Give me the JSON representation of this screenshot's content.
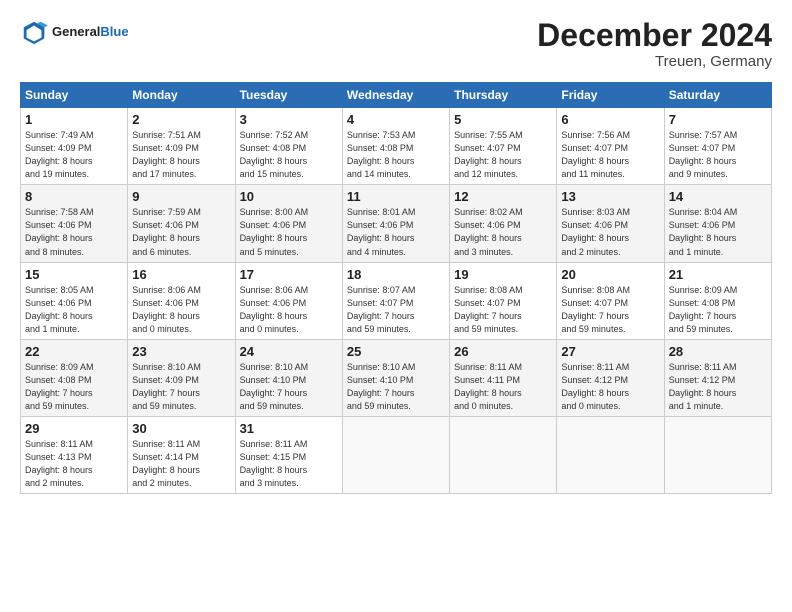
{
  "header": {
    "logo_line1": "General",
    "logo_line2": "Blue",
    "title": "December 2024",
    "subtitle": "Treuen, Germany"
  },
  "days_of_week": [
    "Sunday",
    "Monday",
    "Tuesday",
    "Wednesday",
    "Thursday",
    "Friday",
    "Saturday"
  ],
  "weeks": [
    [
      {
        "day": "1",
        "info": "Sunrise: 7:49 AM\nSunset: 4:09 PM\nDaylight: 8 hours\nand 19 minutes."
      },
      {
        "day": "2",
        "info": "Sunrise: 7:51 AM\nSunset: 4:09 PM\nDaylight: 8 hours\nand 17 minutes."
      },
      {
        "day": "3",
        "info": "Sunrise: 7:52 AM\nSunset: 4:08 PM\nDaylight: 8 hours\nand 15 minutes."
      },
      {
        "day": "4",
        "info": "Sunrise: 7:53 AM\nSunset: 4:08 PM\nDaylight: 8 hours\nand 14 minutes."
      },
      {
        "day": "5",
        "info": "Sunrise: 7:55 AM\nSunset: 4:07 PM\nDaylight: 8 hours\nand 12 minutes."
      },
      {
        "day": "6",
        "info": "Sunrise: 7:56 AM\nSunset: 4:07 PM\nDaylight: 8 hours\nand 11 minutes."
      },
      {
        "day": "7",
        "info": "Sunrise: 7:57 AM\nSunset: 4:07 PM\nDaylight: 8 hours\nand 9 minutes."
      }
    ],
    [
      {
        "day": "8",
        "info": "Sunrise: 7:58 AM\nSunset: 4:06 PM\nDaylight: 8 hours\nand 8 minutes."
      },
      {
        "day": "9",
        "info": "Sunrise: 7:59 AM\nSunset: 4:06 PM\nDaylight: 8 hours\nand 6 minutes."
      },
      {
        "day": "10",
        "info": "Sunrise: 8:00 AM\nSunset: 4:06 PM\nDaylight: 8 hours\nand 5 minutes."
      },
      {
        "day": "11",
        "info": "Sunrise: 8:01 AM\nSunset: 4:06 PM\nDaylight: 8 hours\nand 4 minutes."
      },
      {
        "day": "12",
        "info": "Sunrise: 8:02 AM\nSunset: 4:06 PM\nDaylight: 8 hours\nand 3 minutes."
      },
      {
        "day": "13",
        "info": "Sunrise: 8:03 AM\nSunset: 4:06 PM\nDaylight: 8 hours\nand 2 minutes."
      },
      {
        "day": "14",
        "info": "Sunrise: 8:04 AM\nSunset: 4:06 PM\nDaylight: 8 hours\nand 1 minute."
      }
    ],
    [
      {
        "day": "15",
        "info": "Sunrise: 8:05 AM\nSunset: 4:06 PM\nDaylight: 8 hours\nand 1 minute."
      },
      {
        "day": "16",
        "info": "Sunrise: 8:06 AM\nSunset: 4:06 PM\nDaylight: 8 hours\nand 0 minutes."
      },
      {
        "day": "17",
        "info": "Sunrise: 8:06 AM\nSunset: 4:06 PM\nDaylight: 8 hours\nand 0 minutes."
      },
      {
        "day": "18",
        "info": "Sunrise: 8:07 AM\nSunset: 4:07 PM\nDaylight: 7 hours\nand 59 minutes."
      },
      {
        "day": "19",
        "info": "Sunrise: 8:08 AM\nSunset: 4:07 PM\nDaylight: 7 hours\nand 59 minutes."
      },
      {
        "day": "20",
        "info": "Sunrise: 8:08 AM\nSunset: 4:07 PM\nDaylight: 7 hours\nand 59 minutes."
      },
      {
        "day": "21",
        "info": "Sunrise: 8:09 AM\nSunset: 4:08 PM\nDaylight: 7 hours\nand 59 minutes."
      }
    ],
    [
      {
        "day": "22",
        "info": "Sunrise: 8:09 AM\nSunset: 4:08 PM\nDaylight: 7 hours\nand 59 minutes."
      },
      {
        "day": "23",
        "info": "Sunrise: 8:10 AM\nSunset: 4:09 PM\nDaylight: 7 hours\nand 59 minutes."
      },
      {
        "day": "24",
        "info": "Sunrise: 8:10 AM\nSunset: 4:10 PM\nDaylight: 7 hours\nand 59 minutes."
      },
      {
        "day": "25",
        "info": "Sunrise: 8:10 AM\nSunset: 4:10 PM\nDaylight: 7 hours\nand 59 minutes."
      },
      {
        "day": "26",
        "info": "Sunrise: 8:11 AM\nSunset: 4:11 PM\nDaylight: 8 hours\nand 0 minutes."
      },
      {
        "day": "27",
        "info": "Sunrise: 8:11 AM\nSunset: 4:12 PM\nDaylight: 8 hours\nand 0 minutes."
      },
      {
        "day": "28",
        "info": "Sunrise: 8:11 AM\nSunset: 4:12 PM\nDaylight: 8 hours\nand 1 minute."
      }
    ],
    [
      {
        "day": "29",
        "info": "Sunrise: 8:11 AM\nSunset: 4:13 PM\nDaylight: 8 hours\nand 2 minutes."
      },
      {
        "day": "30",
        "info": "Sunrise: 8:11 AM\nSunset: 4:14 PM\nDaylight: 8 hours\nand 2 minutes."
      },
      {
        "day": "31",
        "info": "Sunrise: 8:11 AM\nSunset: 4:15 PM\nDaylight: 8 hours\nand 3 minutes."
      },
      {
        "day": "",
        "info": ""
      },
      {
        "day": "",
        "info": ""
      },
      {
        "day": "",
        "info": ""
      },
      {
        "day": "",
        "info": ""
      }
    ]
  ]
}
